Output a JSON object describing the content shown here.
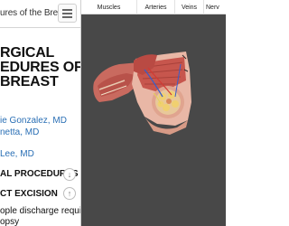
{
  "doc": {
    "header_title": "ures of the Breast",
    "main_title_lines": [
      "RGICAL",
      "EDURES OF",
      "BREAST"
    ],
    "authors": [
      "ie Gonzalez, MD",
      "netta, MD",
      "Lee, MD"
    ],
    "sections": [
      "AL PROCEDURES",
      "CT EXCISION"
    ],
    "body_lines": [
      "ople discharge requiring",
      "opsy"
    ]
  },
  "viewer": {
    "tabs": [
      "Muscles",
      "Arteries",
      "Veins",
      "Nerv"
    ]
  },
  "colors": {
    "author_link": "#2a6fb5",
    "viewer_background": "#484848"
  }
}
